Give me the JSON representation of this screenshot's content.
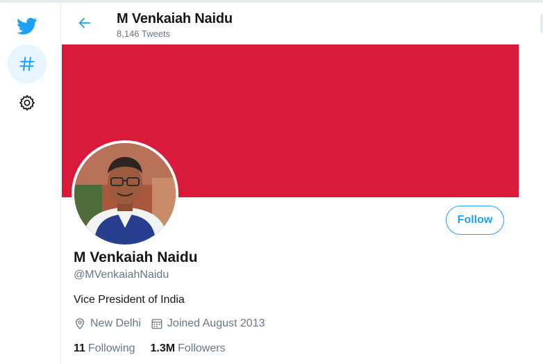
{
  "header": {
    "title": "M Venkaiah Naidu",
    "subtitle": "8,146 Tweets",
    "back_icon": "arrow-left-icon"
  },
  "nav": {
    "items": [
      {
        "icon": "twitter-bird-icon",
        "label": "Home"
      },
      {
        "icon": "hashtag-icon",
        "label": "Explore",
        "active": true
      },
      {
        "icon": "gear-icon",
        "label": "Settings"
      }
    ]
  },
  "profile": {
    "name": "M Venkaiah Naidu",
    "handle": "@MVenkaiahNaidu",
    "bio": "Vice President of India",
    "location": "New Delhi",
    "joined": "Joined August 2013",
    "following_count": "11",
    "following_label": "Following",
    "followers_count": "1.3M",
    "followers_label": "Followers",
    "follow_button": "Follow",
    "banner_color": "#da1a3a"
  },
  "colors": {
    "accent": "#1da1f2",
    "secondary_text": "#657786",
    "primary_text": "#14171a"
  }
}
